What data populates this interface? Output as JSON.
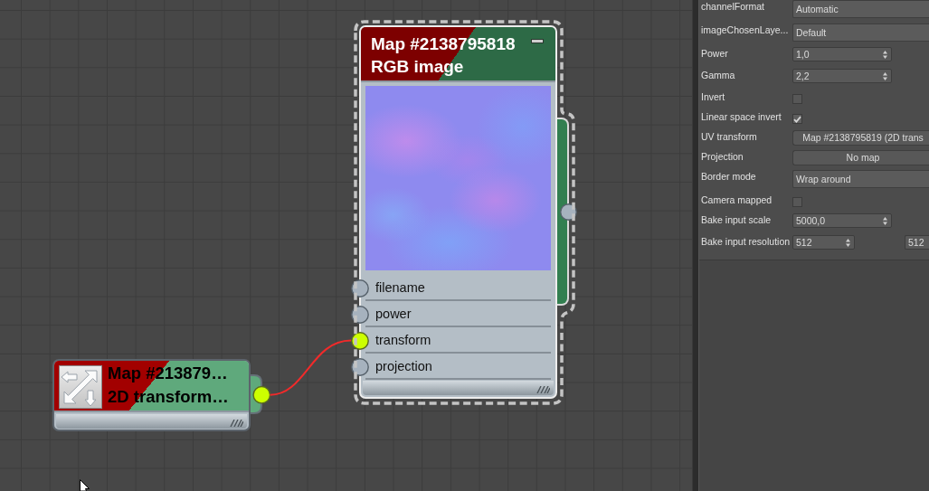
{
  "canvas": {
    "image_node": {
      "title": "Map #2138795818",
      "subtitle": "RGB image",
      "selected": true,
      "inputs": [
        {
          "label": "filename",
          "connected": false
        },
        {
          "label": "power",
          "connected": false
        },
        {
          "label": "transform",
          "connected": true
        },
        {
          "label": "projection",
          "connected": false
        }
      ],
      "output_connected": false
    },
    "transform_node": {
      "title": "Map #213879…",
      "subtitle": "2D transform…",
      "selected": false,
      "output_connected": true
    }
  },
  "panel": {
    "rows": [
      {
        "label": "channelFormat",
        "kind": "dropdown",
        "value": "Automatic"
      },
      {
        "label": "imageChosenLaye...",
        "kind": "dropdown",
        "value": "Default"
      },
      {
        "label": "Power",
        "kind": "spinner",
        "value": "1,0"
      },
      {
        "label": "Gamma",
        "kind": "spinner",
        "value": "2,2"
      },
      {
        "label": "Invert",
        "kind": "checkbox",
        "checked": false
      },
      {
        "label": "Linear space invert",
        "kind": "checkbox",
        "checked": true
      },
      {
        "label": "UV transform",
        "kind": "map_button",
        "value": "Map #2138795819 (2D trans"
      },
      {
        "label": "Projection",
        "kind": "map_button",
        "value": "No map"
      },
      {
        "label": "Border mode",
        "kind": "dropdown",
        "value": "Wrap around"
      },
      {
        "label": "Camera mapped",
        "kind": "checkbox",
        "checked": false
      },
      {
        "label": "Bake input scale",
        "kind": "spinner",
        "value": "5000,0"
      },
      {
        "label": "Bake input resolution",
        "kind": "spinner_pair",
        "values": [
          "512",
          "512"
        ]
      }
    ]
  }
}
